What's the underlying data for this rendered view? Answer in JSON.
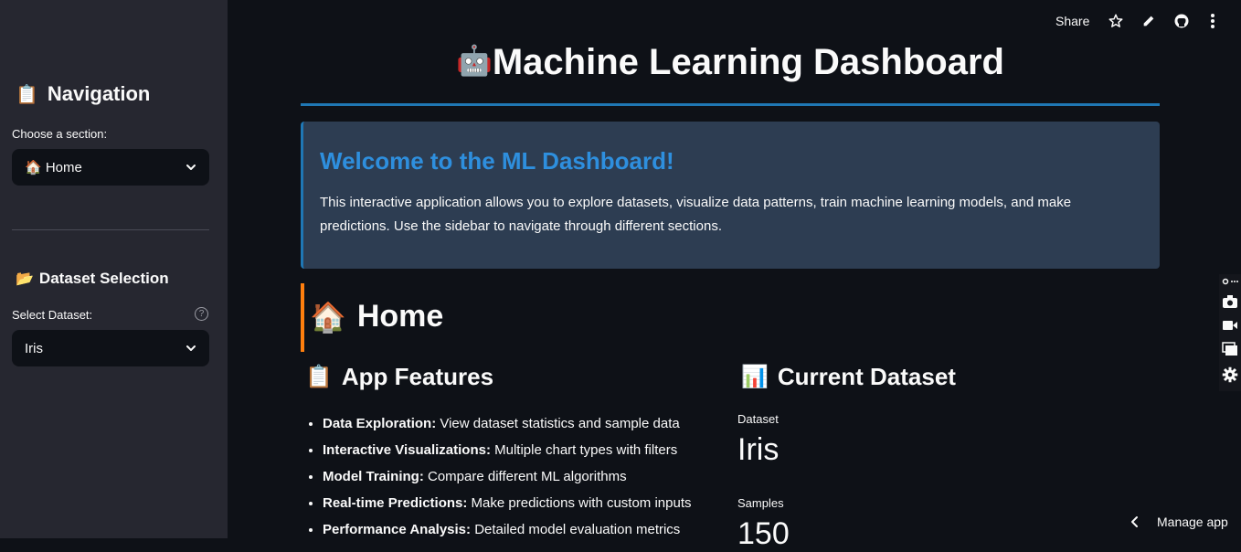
{
  "header": {
    "share_label": "Share",
    "icons": [
      "star-icon",
      "pencil-icon",
      "github-icon",
      "more-vertical-icon"
    ]
  },
  "sidebar": {
    "nav_title": "Navigation",
    "nav_title_icon": "clipboard-icon",
    "choose_label": "Choose a section:",
    "section_value": "🏠 Home",
    "dataset_title": "Dataset Selection",
    "dataset_title_icon": "folder-icon",
    "select_dataset_label": "Select Dataset:",
    "dataset_value": "Iris"
  },
  "main": {
    "title": "Machine Learning Dashboard",
    "title_icon": "robot-icon",
    "welcome": {
      "heading": "Welcome to the ML Dashboard!",
      "text": "This interactive application allows you to explore datasets, visualize data patterns, train machine learning models, and make predictions. Use the sidebar to navigate through different sections."
    },
    "section_title": "Home",
    "section_icon": "house-icon",
    "features_title": "App Features",
    "features_icon": "clipboard-icon",
    "features": [
      {
        "name": "Data Exploration",
        "desc": " View dataset statistics and sample data"
      },
      {
        "name": "Interactive Visualizations",
        "desc": " Multiple chart types with filters"
      },
      {
        "name": "Model Training",
        "desc": " Compare different ML algorithms"
      },
      {
        "name": "Real-time Predictions",
        "desc": " Make predictions with custom inputs"
      },
      {
        "name": "Performance Analysis",
        "desc": " Detailed model evaluation metrics"
      }
    ],
    "current_dataset_title": "Current Dataset",
    "current_dataset_icon": "bar-chart-icon",
    "metrics": [
      {
        "label": "Dataset",
        "value": "Iris"
      },
      {
        "label": "Samples",
        "value": "150"
      }
    ]
  },
  "footer": {
    "manage_label": "Manage app"
  },
  "colors": {
    "background": "#0e1117",
    "sidebar": "#262730",
    "accent_blue": "#1f77b4",
    "accent_orange": "#ff7f0e",
    "info_box": "#2d3d52",
    "heading_blue": "#2e8fde"
  }
}
